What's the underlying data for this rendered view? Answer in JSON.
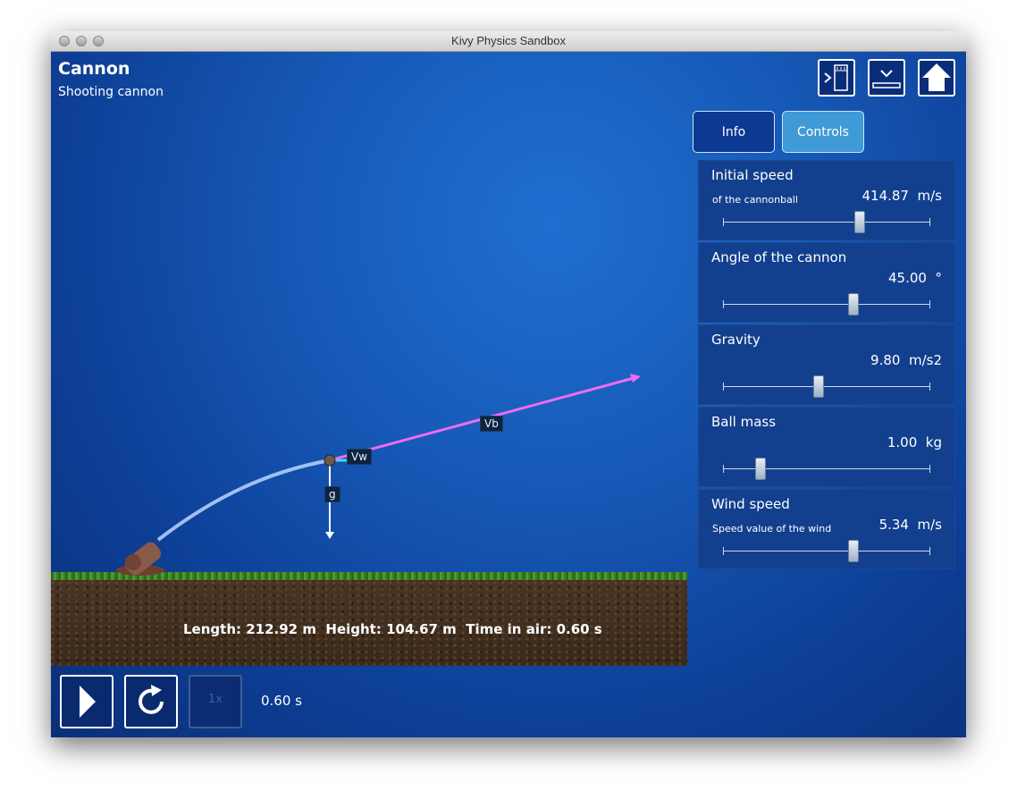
{
  "window": {
    "title": "Kivy Physics Sandbox"
  },
  "header": {
    "title": "Cannon",
    "subtitle": "Shooting cannon"
  },
  "toolbar": {
    "icons": [
      "sidebar-toggle-icon",
      "collapse-panel-icon",
      "home-icon"
    ]
  },
  "tabs": [
    {
      "label": "Info",
      "active": false
    },
    {
      "label": "Controls",
      "active": true
    }
  ],
  "controls": [
    {
      "title": "Initial speed",
      "description": "of the cannonball",
      "value": "414.87  m/s",
      "level": 0.66
    },
    {
      "title": "Angle of the cannon",
      "description": "",
      "value": "45.00  °",
      "level": 0.63
    },
    {
      "title": "Gravity",
      "description": "",
      "value": "9.80  m/s2",
      "level": 0.46
    },
    {
      "title": "Ball mass",
      "description": "",
      "value": "1.00  kg",
      "level": 0.18
    },
    {
      "title": "Wind speed",
      "description": "Speed value of the wind",
      "value": "5.34  m/s",
      "level": 0.63
    }
  ],
  "scene": {
    "stats": "Length: 212.92 m  Height: 104.67 m  Time in air: 0.60 s",
    "vectors": {
      "ball_velocity": "Vb",
      "wind": "Vw",
      "gravity": "g"
    },
    "colors": {
      "velocity": "#ee6cf2",
      "trajectory": "#b9d6ff",
      "gravity": "#ffffff"
    }
  },
  "playback": {
    "time": "0.60 s",
    "speed_label": "1x"
  }
}
